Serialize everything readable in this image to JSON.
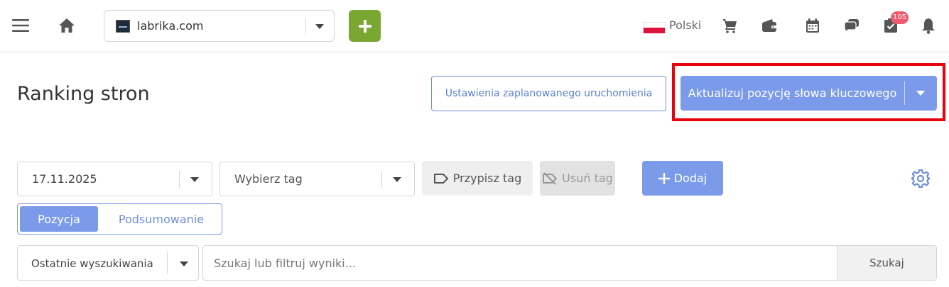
{
  "topbar": {
    "site_name": "labrika.com",
    "language": "Polski",
    "notification_count": "105",
    "colors": {
      "add_button": "#7aa632",
      "badge": "#ef5a6f",
      "flag_red": "#dc143c"
    }
  },
  "header": {
    "title": "Ranking stron",
    "schedule_label": "Ustawienia zaplanowanego uruchomienia",
    "update_label": "Aktualizuj pozycję słowa kluczowego"
  },
  "filters": {
    "date_value": "17.11.2025",
    "tag_placeholder": "Wybierz tag",
    "assign_tag_label": "Przypisz tag",
    "remove_tag_label": "Usuń tag",
    "add_label": "Dodaj"
  },
  "view_toggle": {
    "active_label": "Pozycja",
    "inactive_label": "Podsumowanie"
  },
  "search": {
    "recent_label": "Ostatnie wyszukiwania",
    "placeholder": "Szukaj lub filtruj wyniki...",
    "button_label": "Szukaj"
  },
  "colors": {
    "primary": "#7b9bea",
    "highlight": "#e8000b"
  }
}
